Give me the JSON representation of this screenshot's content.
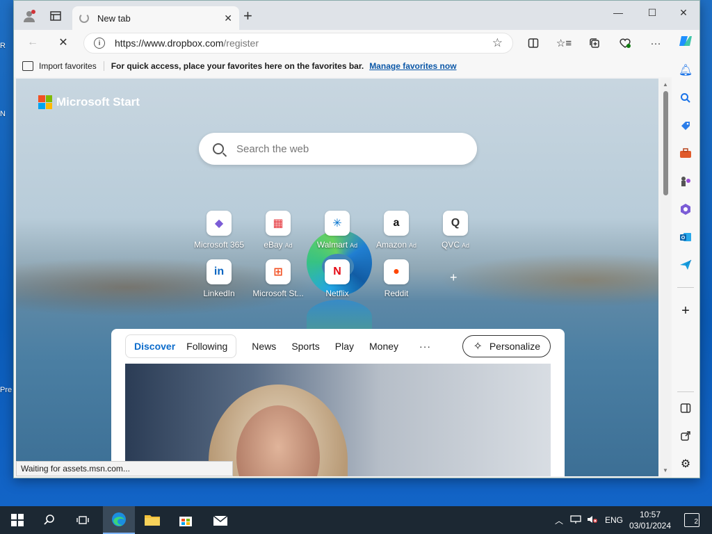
{
  "desktop": {
    "frag_top": "R",
    "frag_mid": "N",
    "frag_bottom": "Pre"
  },
  "browser": {
    "tab_title": "New tab",
    "url_host": "https://www.dropbox.com",
    "url_path": "/register",
    "favorites_import": "Import favorites",
    "favorites_msg": "For quick access, place your favorites here on the favorites bar.",
    "favorites_link": "Manage favorites now",
    "status_text": "Waiting for assets.msn.com..."
  },
  "page": {
    "brand": "Microsoft Start",
    "search_placeholder": "Search the web",
    "quicklinks": [
      {
        "label": "Microsoft 365",
        "ad": "",
        "glyph": "◆",
        "color": "#7b5cd6"
      },
      {
        "label": "eBay",
        "ad": "Ad",
        "glyph": "▦",
        "color": "#e53238"
      },
      {
        "label": "Walmart",
        "ad": "Ad",
        "glyph": "✳",
        "color": "#0071ce"
      },
      {
        "label": "Amazon",
        "ad": "Ad",
        "glyph": "a",
        "color": "#111111"
      },
      {
        "label": "QVC",
        "ad": "Ad",
        "glyph": "Q",
        "color": "#333333"
      },
      {
        "label": "LinkedIn",
        "ad": "",
        "glyph": "in",
        "color": "#0a66c2"
      },
      {
        "label": "Microsoft St...",
        "ad": "",
        "glyph": "⊞",
        "color": "#f25022"
      },
      {
        "label": "Netflix",
        "ad": "",
        "glyph": "N",
        "color": "#e50914"
      },
      {
        "label": "Reddit",
        "ad": "",
        "glyph": "●",
        "color": "#ff4500"
      }
    ],
    "feed_tabs": {
      "discover": "Discover",
      "following": "Following"
    },
    "feed_nav": [
      "News",
      "Sports",
      "Play",
      "Money"
    ],
    "feed_more": "···",
    "personalize": "Personalize"
  },
  "taskbar": {
    "lang": "ENG",
    "time": "10:57",
    "date": "03/01/2024",
    "notifications": "2"
  }
}
